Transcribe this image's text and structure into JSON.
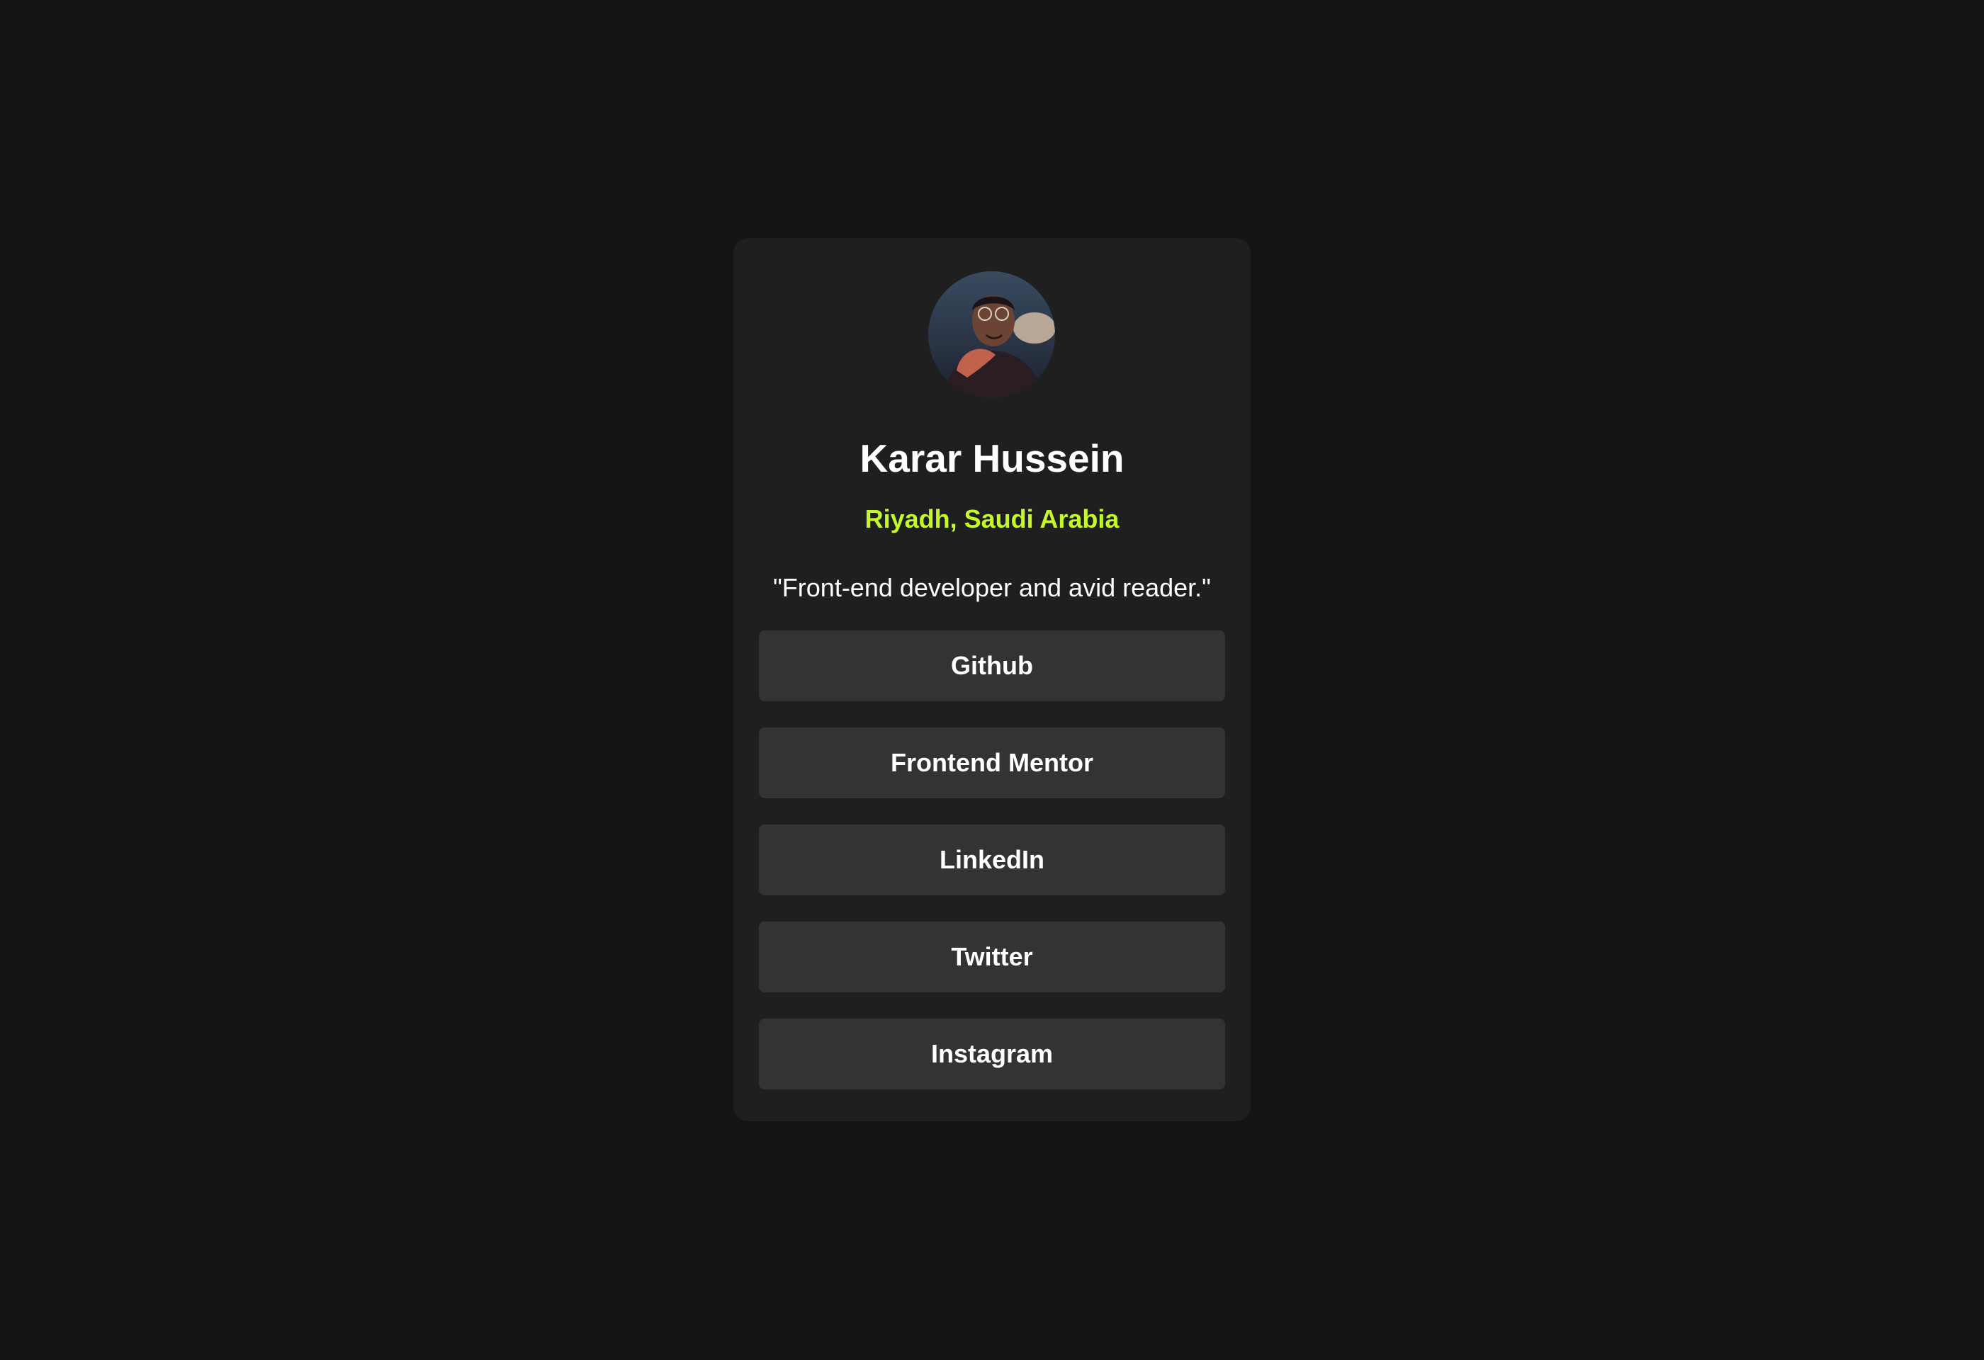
{
  "profile": {
    "name": "Karar Hussein",
    "location": "Riyadh, Saudi Arabia",
    "bio": "\"Front-end developer and avid reader.\"",
    "avatar_icon": "avatar-photo"
  },
  "links": [
    {
      "label": "Github"
    },
    {
      "label": "Frontend Mentor"
    },
    {
      "label": "LinkedIn"
    },
    {
      "label": "Twitter"
    },
    {
      "label": "Instagram"
    }
  ],
  "colors": {
    "background": "#141414",
    "card": "#1f1f1f",
    "button": "#333333",
    "accent": "#c4f82a",
    "text": "#ffffff"
  }
}
